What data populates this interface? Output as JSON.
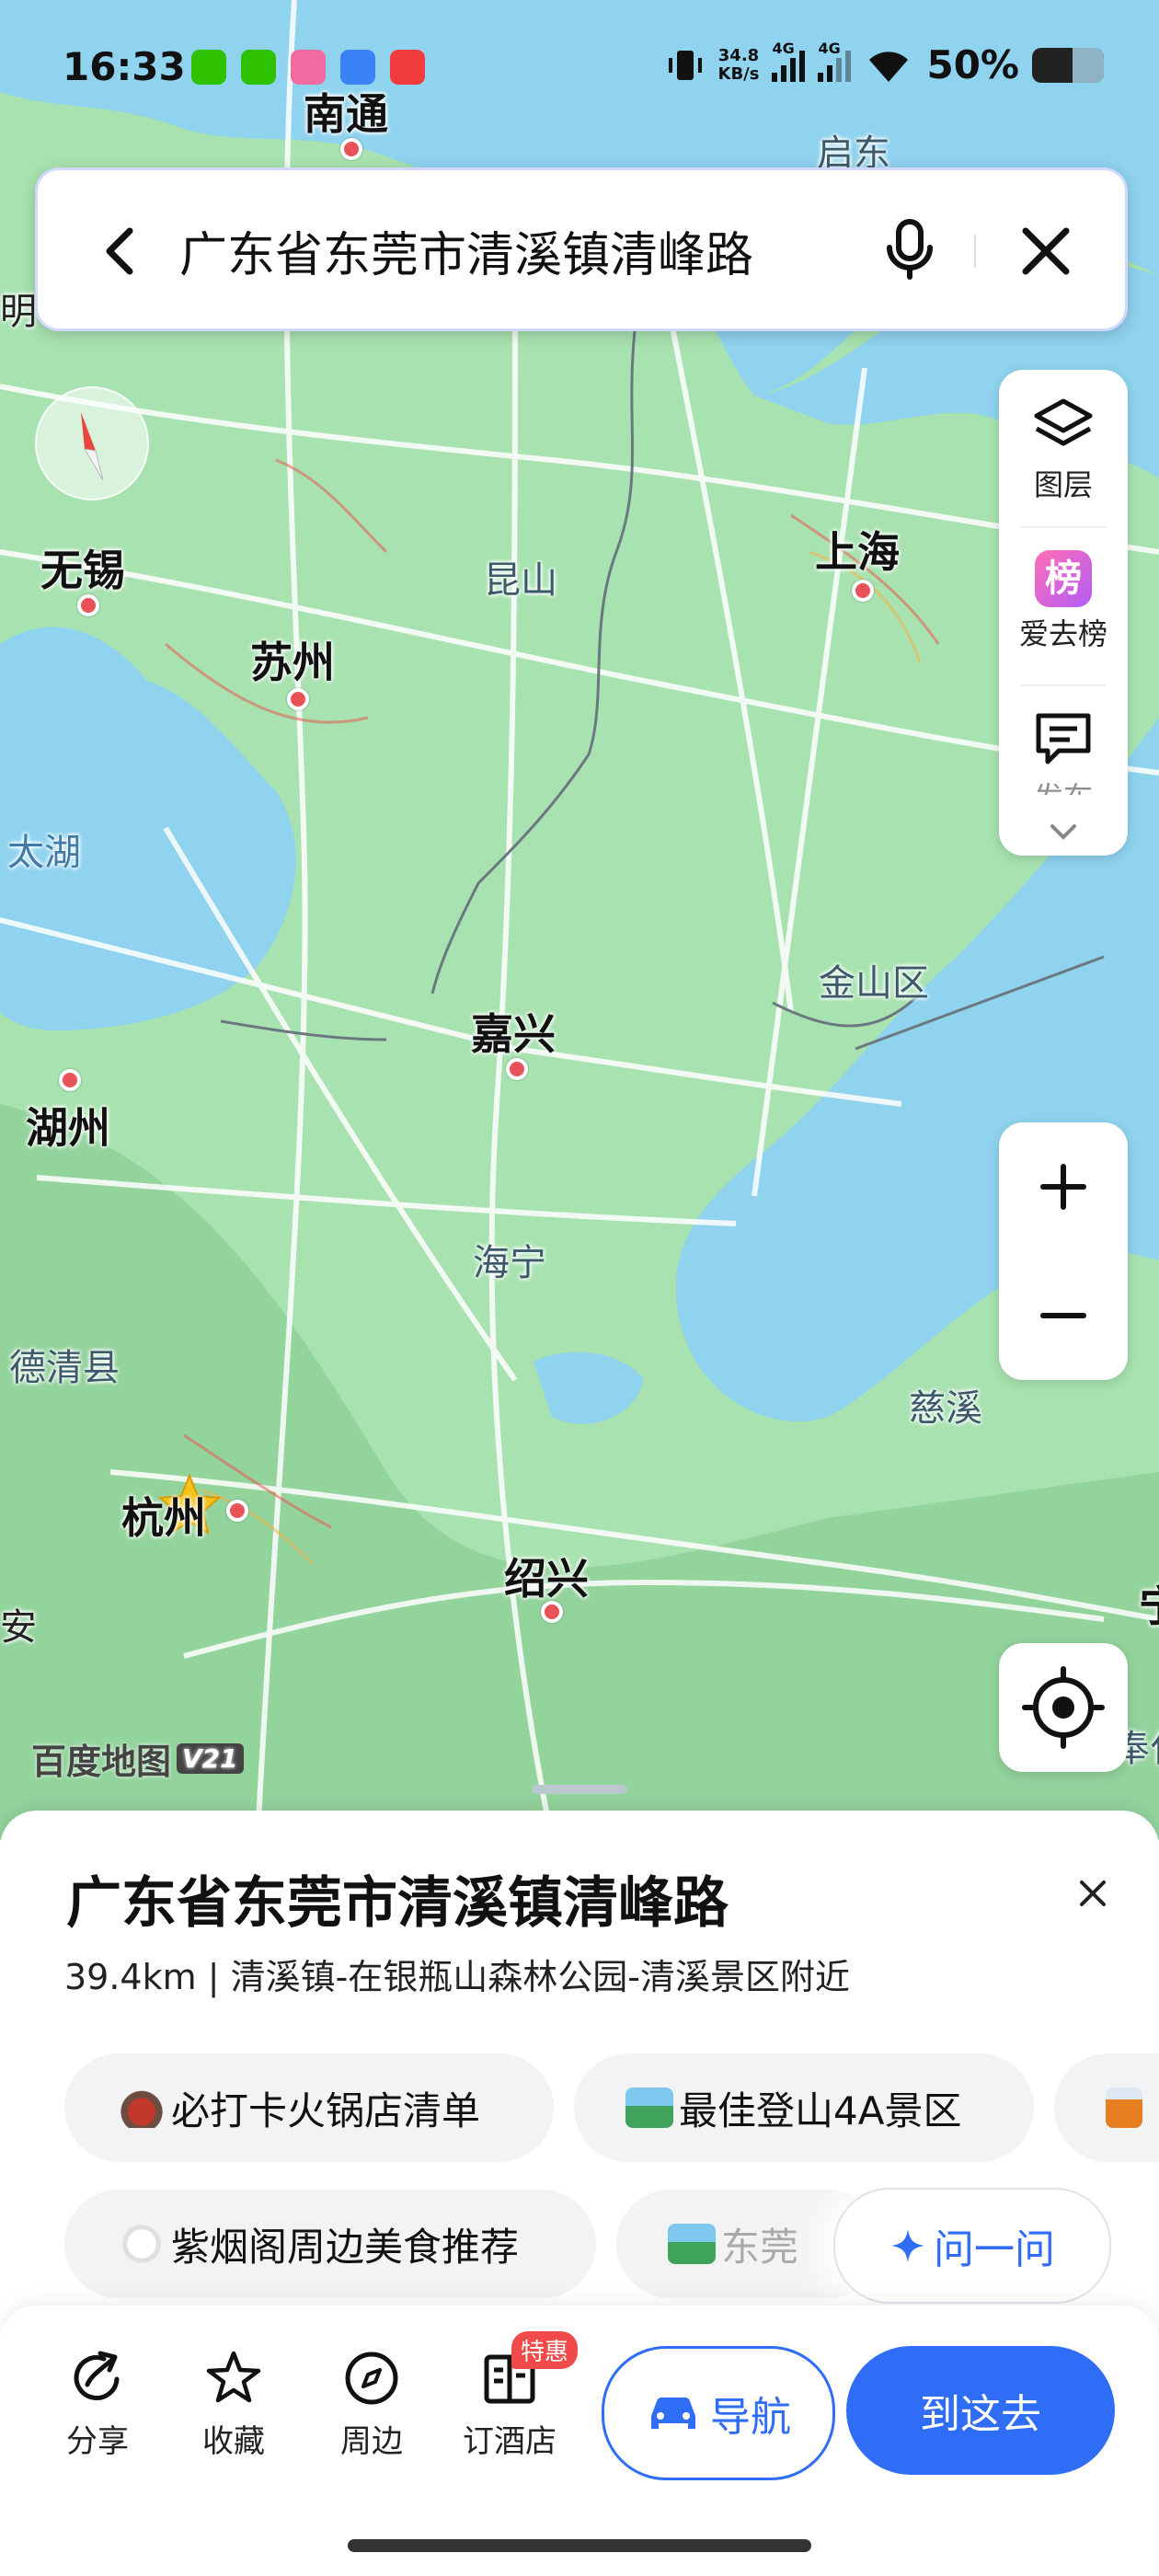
{
  "status_bar": {
    "time": "16:33",
    "net_speed_value": "34.8",
    "net_speed_unit": "KB/s",
    "sim1": "4G",
    "sim2": "4G",
    "battery": "50%"
  },
  "search": {
    "query": "广东省东莞市清溪镇清峰路"
  },
  "map": {
    "labels": {
      "nantong": "南通",
      "qidong": "启东",
      "wuxi": "无锡",
      "kunshan": "昆山",
      "shanghai": "上海",
      "suzhou": "苏州",
      "taihu": "太湖",
      "jiashan": "金山区",
      "jiaxing": "嘉兴",
      "huzhou": "湖州",
      "haining": "海宁",
      "deqing": "德清县",
      "cixi": "慈溪",
      "hangzhou": "杭州",
      "shaoxing": "绍兴",
      "edge_ming": "明",
      "edge_an": "安",
      "edge_ning": "宁",
      "edge_feng": "奉化"
    },
    "watermark": "百度地图",
    "watermark_version": "V21"
  },
  "tools": {
    "layers": "图层",
    "ranking": "爱去榜",
    "ranking_badge": "榜",
    "feedback": "发布"
  },
  "place": {
    "title": "广东省东莞市清溪镇清峰路",
    "subtitle": "39.4km | 清溪镇-在银瓶山森林公园-清溪景区附近"
  },
  "chips": {
    "row1": [
      "必打卡火锅店清单",
      "最佳登山4A景区"
    ],
    "row2": [
      "紫烟阁周边美食推荐",
      "东莞"
    ],
    "ask": "问一问"
  },
  "actions": {
    "share": "分享",
    "favorite": "收藏",
    "nearby": "周边",
    "hotel": "订酒店",
    "hotel_badge": "特惠",
    "navigate": "导航",
    "go_here": "到这去"
  },
  "colors": {
    "accent": "#2f6df6",
    "water": "#8fd3ef",
    "land": "#a8e2b0"
  }
}
